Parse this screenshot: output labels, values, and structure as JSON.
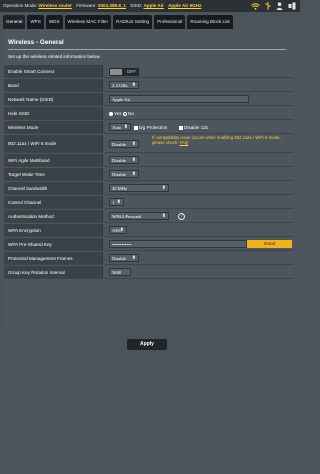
{
  "status": {
    "operation_mode_label": "Operation Mode:",
    "operation_mode_value": "Wireless router",
    "firmware_label": "Firmware:",
    "firmware_value": "3004.388.8_1",
    "ssid_label": "SSID:",
    "ssid_1": "Apple Air",
    "ssid_2": "Apple Air 5GHz",
    "icons": [
      "wifi-icon",
      "usb-icon",
      "user-icon",
      "network-icon"
    ]
  },
  "tabs": [
    "General",
    "WPS",
    "WDS",
    "Wireless MAC Filter",
    "RADIUS Setting",
    "Professional",
    "Roaming Block List"
  ],
  "panel": {
    "title": "Wireless - General",
    "description": "Set up the wireless related information below."
  },
  "fields": {
    "smart_connect": {
      "label": "Enable Smart Connect",
      "value": "OFF"
    },
    "band": {
      "label": "Band",
      "value": "2.4 GHz"
    },
    "ssid": {
      "label": "Network Name (SSID)",
      "value": "Apple Air"
    },
    "hide_ssid": {
      "label": "Hide SSID",
      "yes": "Yes",
      "no": "No",
      "selected": "No"
    },
    "wireless_mode": {
      "label": "Wireless Mode",
      "value": "Auto",
      "option_bg": "b/g Protection",
      "option_11b": "Disable 11b"
    },
    "ax_mode": {
      "label": "802.11ax / WiFi 6 mode",
      "value": "Disable",
      "warning": "If compatibility issue occurs when enabling 802.11ax / WiFi 6 mode, please check:",
      "faq": "FAQ"
    },
    "agile_multiband": {
      "label": "WiFi Agile Multiband",
      "value": "Disable"
    },
    "target_wake_time": {
      "label": "Target Wake Time",
      "value": "Disable"
    },
    "channel_bandwidth": {
      "label": "Channel bandwidth",
      "value": "20 MHz"
    },
    "control_channel": {
      "label": "Control Channel",
      "value": "1"
    },
    "auth_method": {
      "label": "Authentication Method",
      "value": "WPA2-Personal",
      "help": "?"
    },
    "wpa_encryption": {
      "label": "WPA Encryption",
      "value": "AES"
    },
    "wpa_psk": {
      "label": "WPA Pre-Shared Key",
      "value": "••••••••••••",
      "strength": "Good"
    },
    "pmf": {
      "label": "Protected Management Frames",
      "value": "Disable"
    },
    "key_rotation": {
      "label": "Group Key Rotation Interval",
      "value": "3600"
    }
  },
  "apply_label": "Apply",
  "colors": {
    "accent": "#ffd23a",
    "strength": "#f2b21a",
    "warning": "#ffcc33"
  }
}
